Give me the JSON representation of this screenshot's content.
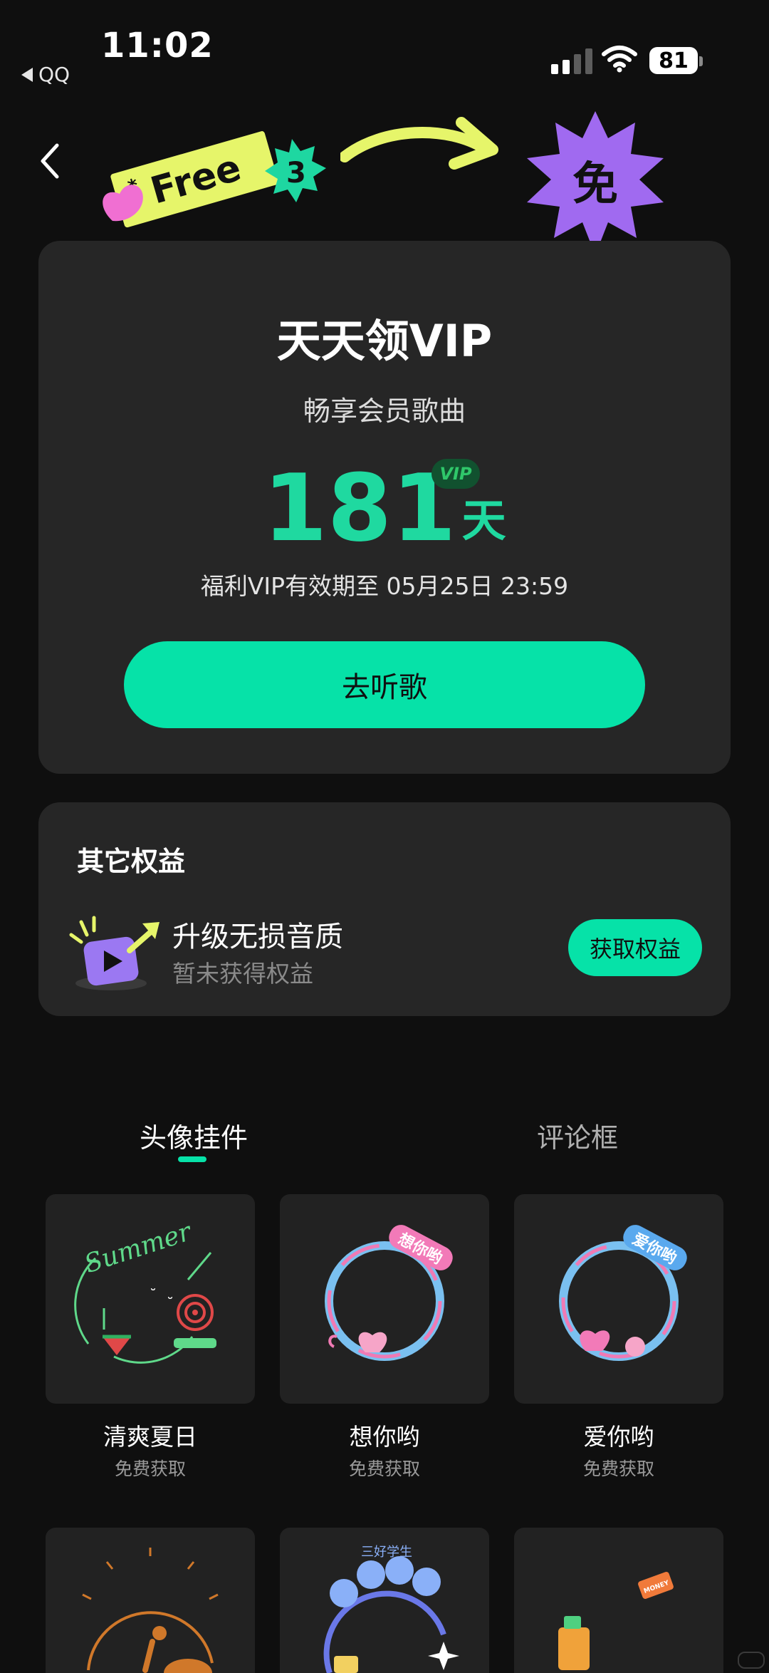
{
  "status_bar": {
    "time": "11:02",
    "back_app": "QQ",
    "battery": "81"
  },
  "header": {
    "ticket_text": "Free",
    "ticket_badge": "3",
    "burst_char": "免"
  },
  "vip_card": {
    "title": "天天领VIP",
    "subtitle": "畅享会员歌曲",
    "days": "181",
    "days_unit": "天",
    "badge": "VIP",
    "expire_text": "福利VIP有效期至 05月25日 23:59",
    "listen_button": "去听歌"
  },
  "other_rights": {
    "title": "其它权益",
    "items": [
      {
        "name": "升级无损音质",
        "status": "暂未获得权益",
        "button": "获取权益"
      }
    ]
  },
  "tabs": [
    {
      "label": "头像挂件",
      "active": true
    },
    {
      "label": "评论框",
      "active": false
    }
  ],
  "pendants": [
    {
      "name": "清爽夏日",
      "sub": "免费获取",
      "art_text": "Summer"
    },
    {
      "name": "想你哟",
      "sub": "免费获取",
      "art_text": "想你哟"
    },
    {
      "name": "爱你哟",
      "sub": "免费获取",
      "art_text": "爱你哟"
    },
    {
      "name": "",
      "sub": "",
      "art_text": ""
    },
    {
      "name": "",
      "sub": "",
      "art_text": "三好学生"
    },
    {
      "name": "",
      "sub": "",
      "art_text": "MONEY"
    }
  ],
  "colors": {
    "accent": "#06e2a8",
    "card": "#262626",
    "background": "#0f0f0f"
  }
}
